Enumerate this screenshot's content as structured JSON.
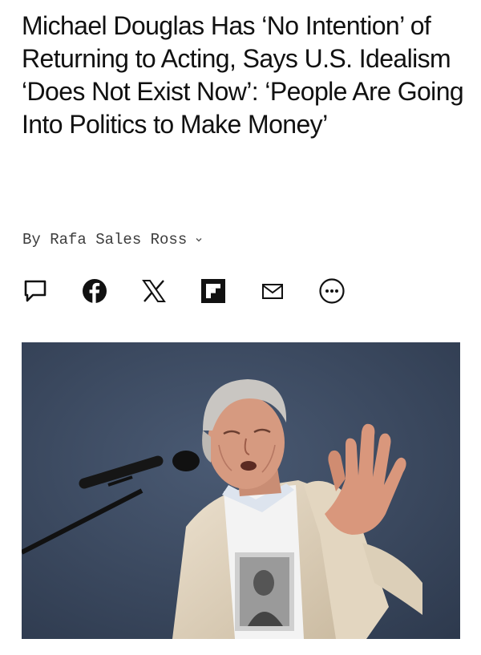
{
  "article": {
    "headline": "Michael Douglas Has ‘No Intention’ of Returning to Acting, Says U.S. Idealism ‘Does Not Exist Now’: ‘People Are Going Into Politics to Make Money’",
    "byline": "By Rafa Sales Ross"
  },
  "share": {
    "icons": [
      "comment-icon",
      "facebook-icon",
      "x-icon",
      "flipboard-icon",
      "email-icon",
      "more-icon"
    ]
  },
  "colors": {
    "text": "#111111",
    "byline": "#3c3c3c",
    "photo_background": "#3e4c63"
  }
}
